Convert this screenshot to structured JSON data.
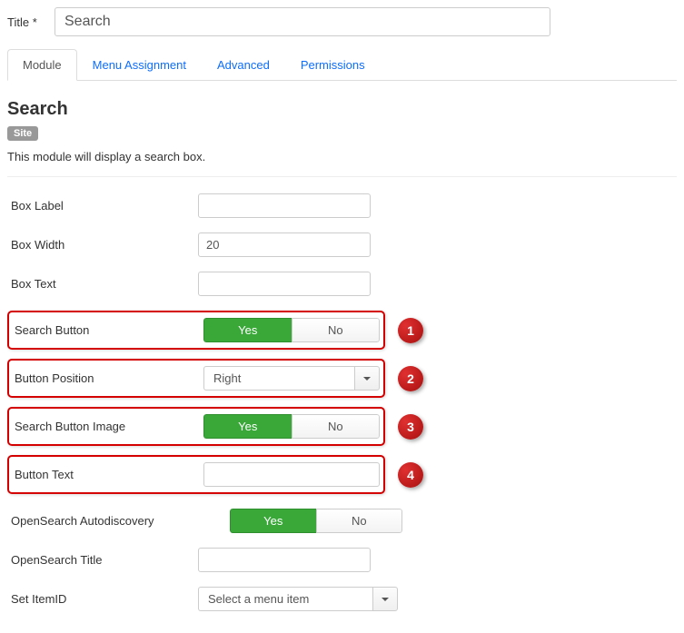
{
  "title": {
    "label": "Title *",
    "value": "Search"
  },
  "tabs": {
    "module": "Module",
    "menu": "Menu Assignment",
    "advanced": "Advanced",
    "permissions": "Permissions"
  },
  "module": {
    "heading": "Search",
    "badge": "Site",
    "description": "This module will display a search box."
  },
  "fields": {
    "box_label": {
      "label": "Box Label",
      "value": ""
    },
    "box_width": {
      "label": "Box Width",
      "value": "20"
    },
    "box_text": {
      "label": "Box Text",
      "value": ""
    },
    "search_button": {
      "label": "Search Button",
      "yes": "Yes",
      "no": "No"
    },
    "button_position": {
      "label": "Button Position",
      "value": "Right"
    },
    "search_button_image": {
      "label": "Search Button Image",
      "yes": "Yes",
      "no": "No"
    },
    "button_text": {
      "label": "Button Text",
      "value": ""
    },
    "opensearch_auto": {
      "label": "OpenSearch Autodiscovery",
      "yes": "Yes",
      "no": "No"
    },
    "opensearch_title": {
      "label": "OpenSearch Title",
      "value": ""
    },
    "set_itemid": {
      "label": "Set ItemID",
      "value": "Select a menu item"
    }
  },
  "callouts": {
    "c1": "1",
    "c2": "2",
    "c3": "3",
    "c4": "4"
  }
}
